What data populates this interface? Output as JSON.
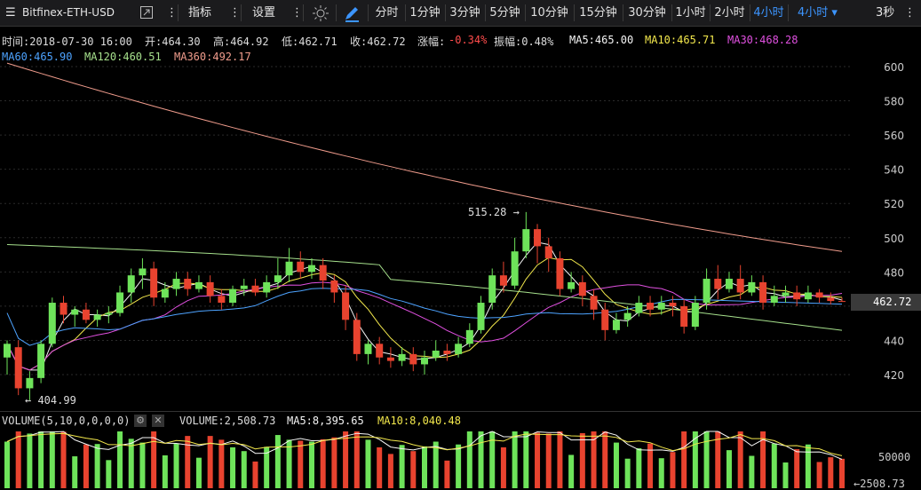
{
  "toolbar": {
    "symbol": "Bitfinex-ETH-USD",
    "indicators_label": "指标",
    "settings_label": "设置",
    "intervals": [
      "分时",
      "1分钟",
      "3分钟",
      "5分钟",
      "10分钟",
      "15分钟",
      "30分钟",
      "1小时",
      "2小时",
      "4小时"
    ],
    "active_interval": "4小时",
    "interval_dropdown": "4小时",
    "refresh_label": "3秒"
  },
  "ohlc": {
    "time": "时间:2018-07-30 16:00",
    "open": "开:464.30",
    "high": "高:464.92",
    "low": "低:462.71",
    "close": "收:462.72",
    "change_label": "涨幅:",
    "change_value": "-0.34%",
    "amplitude": "振幅:0.48%",
    "ma5": "MA5:465.00",
    "ma10": "MA10:465.71",
    "ma30": "MA30:468.28",
    "ma60": "MA60:465.90",
    "ma120": "MA120:460.51",
    "ma360": "MA360:492.17"
  },
  "colors": {
    "up": "#6ee35a",
    "down": "#e8432f",
    "ma5": "#f5f5f5",
    "ma10": "#f3e84c",
    "ma30": "#e050e0",
    "ma60": "#4da3ff",
    "ma120": "#a6e08c",
    "ma360": "#f09c8c",
    "change_down": "#ff4c4c"
  },
  "price_axis": {
    "ticks": [
      "600",
      "580",
      "560",
      "540",
      "520",
      "500",
      "480",
      "460",
      "440",
      "420"
    ],
    "current_price": "462.72",
    "max_label": "515.28",
    "min_label": "404.99"
  },
  "volume": {
    "header": "VOLUME(5,10,0,0,0,0)",
    "value": "VOLUME:2,508.73",
    "ma5": "MA5:8,395.65",
    "ma10": "MA10:8,040.48",
    "axis_tick": "50000",
    "current": "2508.73"
  },
  "chart_data": {
    "type": "candlestick",
    "ylim": [
      410,
      610
    ],
    "candles_approx": [
      [
        430,
        438,
        420,
        440
      ],
      [
        436,
        412,
        408,
        440
      ],
      [
        412,
        418,
        405,
        422
      ],
      [
        418,
        438,
        415,
        440
      ],
      [
        438,
        462,
        436,
        465
      ],
      [
        462,
        455,
        450,
        466
      ],
      [
        455,
        458,
        448,
        460
      ],
      [
        458,
        452,
        450,
        462
      ],
      [
        452,
        455,
        448,
        458
      ],
      [
        455,
        456,
        450,
        460
      ],
      [
        456,
        468,
        454,
        472
      ],
      [
        468,
        478,
        462,
        482
      ],
      [
        478,
        482,
        470,
        488
      ],
      [
        482,
        465,
        460,
        486
      ],
      [
        465,
        470,
        462,
        474
      ],
      [
        470,
        476,
        466,
        480
      ],
      [
        476,
        470,
        466,
        480
      ],
      [
        470,
        474,
        468,
        478
      ],
      [
        474,
        466,
        462,
        478
      ],
      [
        466,
        462,
        458,
        470
      ],
      [
        462,
        470,
        460,
        472
      ],
      [
        470,
        472,
        466,
        476
      ],
      [
        472,
        468,
        466,
        476
      ],
      [
        468,
        474,
        465,
        478
      ],
      [
        474,
        478,
        470,
        488
      ],
      [
        478,
        486,
        474,
        494
      ],
      [
        486,
        480,
        476,
        492
      ],
      [
        480,
        484,
        476,
        488
      ],
      [
        484,
        475,
        470,
        488
      ],
      [
        475,
        468,
        462,
        478
      ],
      [
        468,
        452,
        446,
        472
      ],
      [
        452,
        432,
        428,
        456
      ],
      [
        432,
        438,
        426,
        440
      ],
      [
        438,
        430,
        426,
        442
      ],
      [
        430,
        428,
        424,
        436
      ],
      [
        428,
        432,
        425,
        436
      ],
      [
        432,
        426,
        422,
        436
      ],
      [
        426,
        430,
        420,
        434
      ],
      [
        430,
        434,
        428,
        440
      ],
      [
        434,
        432,
        428,
        438
      ],
      [
        432,
        438,
        430,
        442
      ],
      [
        438,
        446,
        436,
        450
      ],
      [
        446,
        462,
        444,
        466
      ],
      [
        462,
        478,
        458,
        482
      ],
      [
        478,
        472,
        468,
        486
      ],
      [
        472,
        492,
        470,
        500
      ],
      [
        492,
        505,
        488,
        515
      ],
      [
        505,
        495,
        485,
        508
      ],
      [
        495,
        488,
        480,
        500
      ],
      [
        488,
        470,
        466,
        492
      ],
      [
        470,
        474,
        468,
        480
      ],
      [
        474,
        466,
        460,
        478
      ],
      [
        466,
        458,
        452,
        470
      ],
      [
        458,
        446,
        440,
        462
      ],
      [
        446,
        452,
        444,
        456
      ],
      [
        452,
        456,
        448,
        460
      ],
      [
        456,
        462,
        454,
        466
      ],
      [
        462,
        458,
        454,
        466
      ],
      [
        458,
        462,
        455,
        466
      ],
      [
        462,
        460,
        454,
        466
      ],
      [
        460,
        448,
        444,
        464
      ],
      [
        448,
        462,
        446,
        466
      ],
      [
        462,
        476,
        458,
        482
      ],
      [
        476,
        470,
        464,
        484
      ],
      [
        470,
        476,
        468,
        480
      ],
      [
        476,
        468,
        464,
        484
      ],
      [
        468,
        474,
        466,
        478
      ],
      [
        474,
        462,
        458,
        478
      ],
      [
        462,
        466,
        460,
        472
      ],
      [
        466,
        468,
        462,
        472
      ],
      [
        468,
        464,
        460,
        472
      ],
      [
        464,
        468,
        462,
        472
      ],
      [
        468,
        465,
        462,
        470
      ],
      [
        465,
        463,
        461,
        468
      ],
      [
        463,
        462.7,
        462.7,
        465
      ]
    ]
  }
}
